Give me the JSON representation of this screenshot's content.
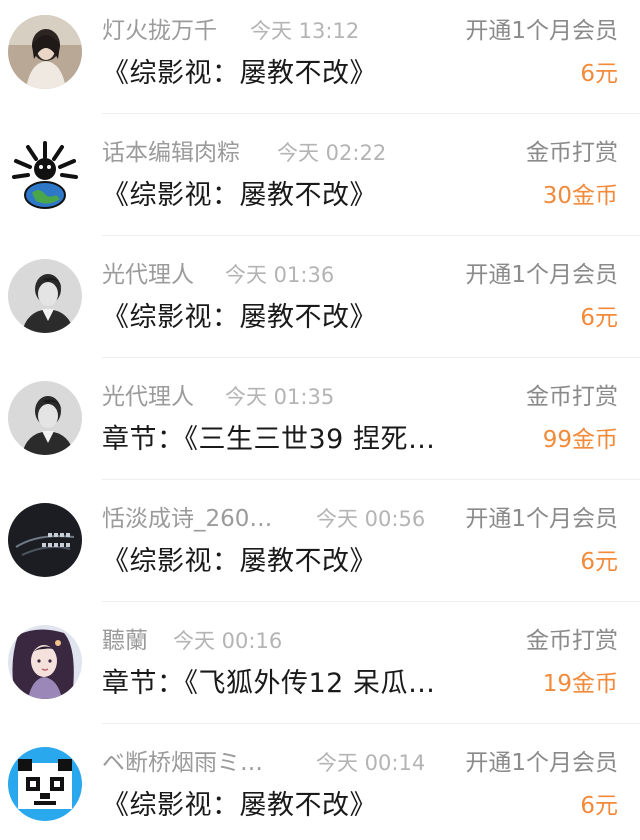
{
  "records": [
    {
      "name": "灯火拢万千",
      "time": "今天 13:12",
      "action": "开通1个月会员",
      "title": "《综影视：屡教不改》",
      "amount": "6元",
      "avatar": "girl-photo"
    },
    {
      "name": "话本编辑肉粽",
      "time": "今天 02:22",
      "action": "金币打赏",
      "title": "《综影视：屡教不改》",
      "amount": "30金币",
      "avatar": "cartoon-earth"
    },
    {
      "name": "光代理人",
      "time": "今天 01:36",
      "action": "开通1个月会员",
      "title": "《综影视：屡教不改》",
      "amount": "6元",
      "avatar": "man-portrait"
    },
    {
      "name": "光代理人",
      "time": "今天 01:35",
      "action": "金币打赏",
      "title": "章节：《三生三世39  捏死…",
      "amount": "99金币",
      "avatar": "man-portrait"
    },
    {
      "name": "恬淡成诗_260…",
      "time": "今天 00:56",
      "action": "开通1个月会员",
      "title": "《综影视：屡教不改》",
      "amount": "6元",
      "avatar": "dark-calligraphy"
    },
    {
      "name": "聽蘭",
      "time": "今天 00:16",
      "action": "金币打赏",
      "title": "章节：《飞狐外传12  呆瓜…",
      "amount": "19金币",
      "avatar": "anime-girl"
    },
    {
      "name": "ベ断桥烟雨ミ…",
      "time": "今天 00:14",
      "action": "开通1个月会员",
      "title": "《综影视：屡教不改》",
      "amount": "6元",
      "avatar": "pixel-panda"
    }
  ],
  "colors": {
    "name": "#9b9b9b",
    "time": "#b4b4b4",
    "action": "#8a8a8a",
    "title": "#1a1a1a",
    "amount": "#f28a3a"
  }
}
